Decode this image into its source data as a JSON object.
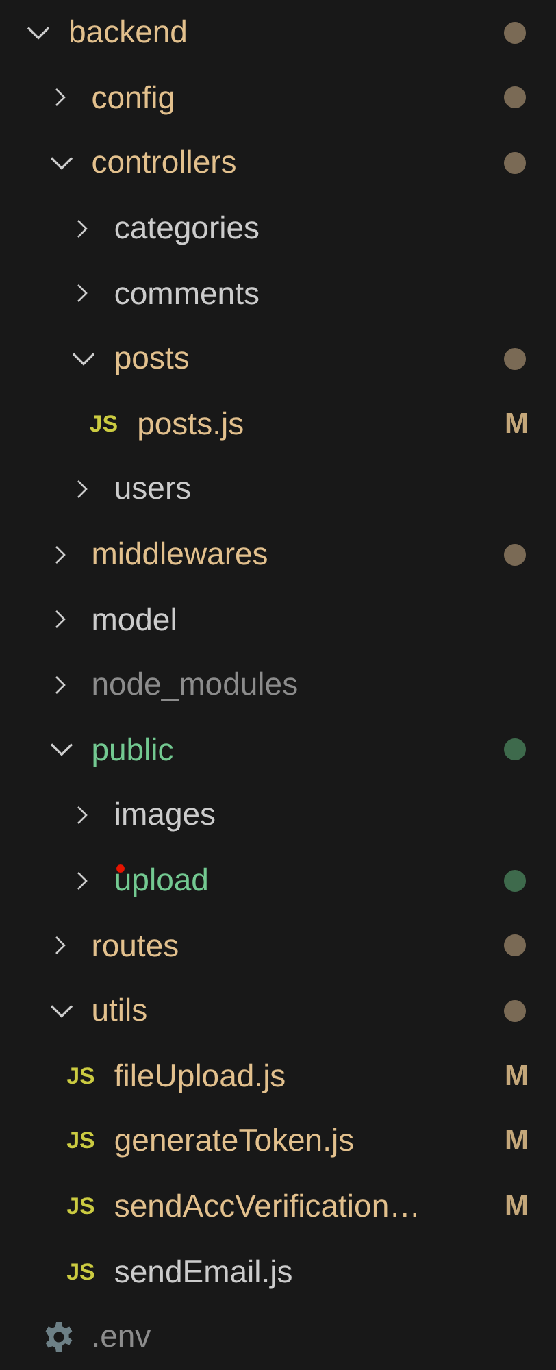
{
  "tree": [
    {
      "name": "backend",
      "kind": "folder",
      "expanded": true,
      "color": "#e2c08d",
      "dot": {
        "color": "#7a6a55"
      },
      "children": [
        {
          "name": "config",
          "kind": "folder",
          "expanded": false,
          "color": "#e2c08d",
          "dot": {
            "color": "#7a6a55"
          }
        },
        {
          "name": "controllers",
          "kind": "folder",
          "expanded": true,
          "color": "#e2c08d",
          "dot": {
            "color": "#7a6a55"
          },
          "children": [
            {
              "name": "categories",
              "kind": "folder",
              "expanded": false,
              "color": "#cccccc"
            },
            {
              "name": "comments",
              "kind": "folder",
              "expanded": false,
              "color": "#cccccc"
            },
            {
              "name": "posts",
              "kind": "folder",
              "expanded": true,
              "color": "#e2c08d",
              "dot": {
                "color": "#7a6a55"
              },
              "children": [
                {
                  "name": "posts.js",
                  "kind": "script",
                  "icon_label": "JS",
                  "color": "#e2c08d",
                  "badge": "M"
                }
              ]
            },
            {
              "name": "users",
              "kind": "folder",
              "expanded": false,
              "color": "#cccccc"
            }
          ]
        },
        {
          "name": "middlewares",
          "kind": "folder",
          "expanded": false,
          "color": "#e2c08d",
          "dot": {
            "color": "#7a6a55"
          }
        },
        {
          "name": "model",
          "kind": "folder",
          "expanded": false,
          "color": "#cccccc"
        },
        {
          "name": "node_modules",
          "kind": "folder",
          "expanded": false,
          "color": "#8c8c8c"
        },
        {
          "name": "public",
          "kind": "folder",
          "expanded": true,
          "color": "#73c991",
          "dot": {
            "color": "#3e6a4c"
          },
          "children": [
            {
              "name": "images",
              "kind": "folder",
              "expanded": false,
              "color": "#cccccc"
            },
            {
              "name": "upload",
              "kind": "folder",
              "expanded": false,
              "color": "#73c991",
              "problem": true,
              "dot": {
                "color": "#3e6a4c"
              }
            }
          ]
        },
        {
          "name": "routes",
          "kind": "folder",
          "expanded": false,
          "color": "#e2c08d",
          "dot": {
            "color": "#7a6a55"
          }
        },
        {
          "name": "utils",
          "kind": "folder",
          "expanded": true,
          "color": "#e2c08d",
          "dot": {
            "color": "#7a6a55"
          },
          "children": [
            {
              "name": "fileUpload.js",
              "kind": "script",
              "icon_label": "JS",
              "color": "#e2c08d",
              "badge": "M"
            },
            {
              "name": "generateToken.js",
              "kind": "script",
              "icon_label": "JS",
              "color": "#e2c08d",
              "badge": "M"
            },
            {
              "name": "sendAccVerification…",
              "kind": "script",
              "icon_label": "JS",
              "color": "#e2c08d",
              "badge": "M"
            },
            {
              "name": "sendEmail.js",
              "kind": "script",
              "icon_label": "JS",
              "color": "#cccccc"
            }
          ]
        },
        {
          "name": ".env",
          "kind": "settings",
          "color": "#8c8c8c"
        }
      ]
    }
  ]
}
